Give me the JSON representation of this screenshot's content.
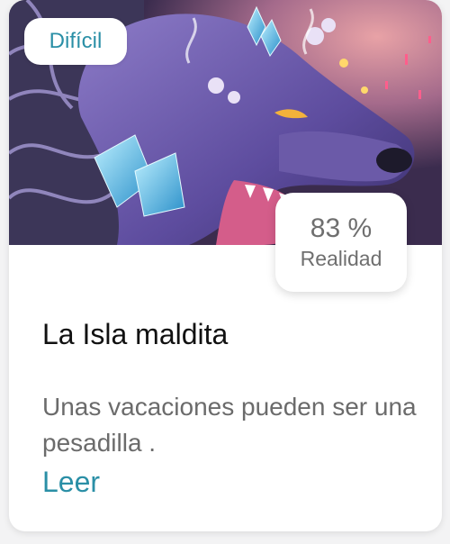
{
  "story": {
    "difficulty": "Difícil",
    "realism_value": "83 %",
    "realism_label": "Realidad",
    "title": "La Isla maldita",
    "description": "Unas vacaciones pueden ser una pesadilla .",
    "read_label": "Leer"
  },
  "colors": {
    "accent": "#2a8fa6",
    "title": "#111111",
    "muted": "#6b6b6b"
  },
  "icons": {
    "cover": "wolf-illustration"
  }
}
